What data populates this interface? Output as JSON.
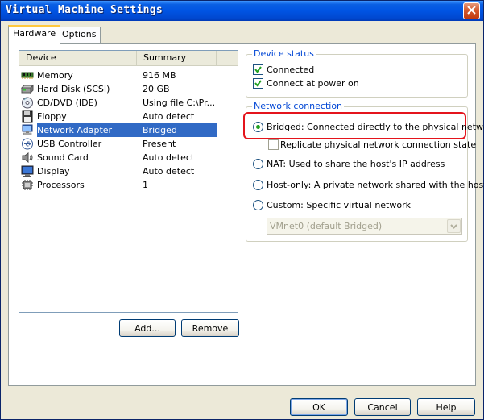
{
  "window": {
    "title": "Virtual Machine Settings"
  },
  "tabs": [
    {
      "label": "Hardware",
      "active": true
    },
    {
      "label": "Options",
      "active": false
    }
  ],
  "device_list": {
    "columns": [
      "Device",
      "Summary"
    ],
    "rows": [
      {
        "device": "Memory",
        "summary": "916 MB",
        "icon": "memory-icon"
      },
      {
        "device": "Hard Disk (SCSI)",
        "summary": "20 GB",
        "icon": "hard-disk-icon"
      },
      {
        "device": "CD/DVD (IDE)",
        "summary": "Using file C:\\Pr...",
        "icon": "cd-dvd-icon"
      },
      {
        "device": "Floppy",
        "summary": "Auto detect",
        "icon": "floppy-icon"
      },
      {
        "device": "Network Adapter",
        "summary": "Bridged",
        "icon": "network-adapter-icon",
        "selected": true
      },
      {
        "device": "USB Controller",
        "summary": "Present",
        "icon": "usb-icon"
      },
      {
        "device": "Sound Card",
        "summary": "Auto detect",
        "icon": "sound-card-icon"
      },
      {
        "device": "Display",
        "summary": "Auto detect",
        "icon": "display-icon"
      },
      {
        "device": "Processors",
        "summary": "1",
        "icon": "processor-icon"
      }
    ]
  },
  "buttons": {
    "add": "Add...",
    "remove": "Remove",
    "ok": "OK",
    "cancel": "Cancel",
    "help": "Help"
  },
  "device_status": {
    "label": "Device status",
    "connected": "Connected",
    "connect_at_power_on": "Connect at power on"
  },
  "network_connection": {
    "label": "Network connection",
    "bridged": "Bridged: Connected directly to the physical network",
    "replicate": "Replicate physical network connection state",
    "nat": "NAT: Used to share the host's IP address",
    "host_only": "Host-only: A private network shared with the host",
    "custom": "Custom: Specific virtual network",
    "vmnet_value": "VMnet0 (default Bridged)"
  },
  "colors": {
    "title_bar": "#0054e3",
    "selection": "#316ac5",
    "highlight": "#e4141c",
    "group_label": "#0046d5"
  }
}
